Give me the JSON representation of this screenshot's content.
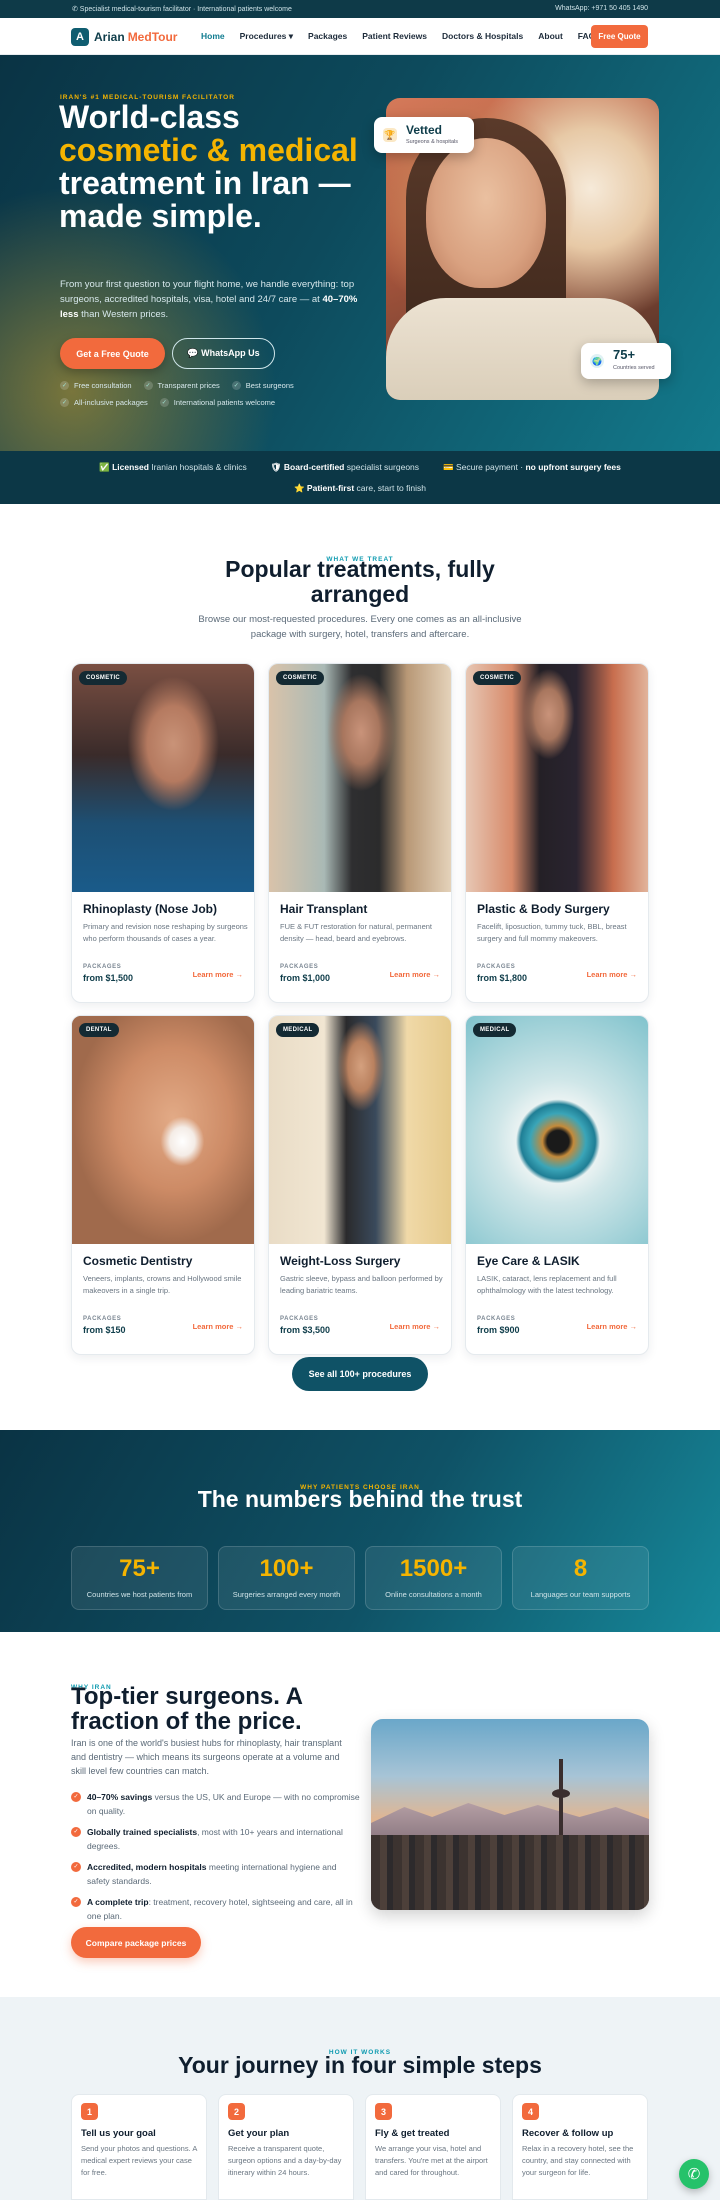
{
  "topbar": {
    "left": "✆ Specialist medical-tourism facilitator · International patients welcome",
    "right": "WhatsApp: +971 50 405 1490"
  },
  "nav": {
    "logo_mark": "A",
    "logo_name": "Arian",
    "logo_accent": "MedTour",
    "items": [
      "Home",
      "Procedures ▾",
      "Packages",
      "Patient Reviews",
      "Doctors & Hospitals",
      "About",
      "FAQ"
    ],
    "cta": "Free Quote"
  },
  "hero": {
    "eyebrow": "IRAN'S #1 MEDICAL-TOURISM FACILITATOR",
    "title_1": "World-class",
    "title_gold": "cosmetic & medical",
    "title_2": "treatment in Iran — made simple.",
    "sub_1": "From your first question to your flight home, we handle everything: top surgeons, accredited hospitals, visa, hotel and 24/7 care — at",
    "sub_bold": "40–70% less",
    "sub_2": "than Western prices.",
    "btn_primary": "Get a Free Quote",
    "btn_secondary": "💬 WhatsApp Us",
    "checks": [
      "Free consultation",
      "Transparent prices",
      "Best surgeons",
      "All-inclusive packages",
      "International patients welcome"
    ],
    "vetted_title": "Vetted",
    "vetted_sub": "Surgeons & hospitals",
    "count_value": "75+",
    "count_label": "Countries served"
  },
  "trust": {
    "item1_bold": "✅ Licensed",
    "item1_rest": "Iranian hospitals & clinics",
    "item2_bold": "🛡 Board-certified",
    "item2_rest": "specialist surgeons",
    "item3_rest": "💳 Secure payment ·",
    "item3_bold": "no upfront surgery fees",
    "item4_bold": "⭐ Patient-first",
    "item4_rest": "care, start to finish"
  },
  "treatments": {
    "eyebrow": "WHAT WE TREAT",
    "title": "Popular treatments, fully arranged",
    "sub": "Browse our most-requested procedures. Every one comes as an all-inclusive package with surgery, hotel, transfers and aftercare.",
    "packages_label": "PACKAGES",
    "more_label": "Learn more →",
    "cards": [
      {
        "tag": "COSMETIC",
        "name": "Rhinoplasty (Nose Job)",
        "desc": "Primary and revision nose reshaping by surgeons who perform thousands of cases a year.",
        "price": "from $1,500"
      },
      {
        "tag": "COSMETIC",
        "name": "Hair Transplant",
        "desc": "FUE & FUT restoration for natural, permanent density — head, beard and eyebrows.",
        "price": "from $1,000"
      },
      {
        "tag": "COSMETIC",
        "name": "Plastic & Body Surgery",
        "desc": "Facelift, liposuction, tummy tuck, BBL, breast surgery and full mommy makeovers.",
        "price": "from $1,800"
      },
      {
        "tag": "DENTAL",
        "name": "Cosmetic Dentistry",
        "desc": "Veneers, implants, crowns and Hollywood smile makeovers in a single trip.",
        "price": "from $150"
      },
      {
        "tag": "MEDICAL",
        "name": "Weight-Loss Surgery",
        "desc": "Gastric sleeve, bypass and balloon performed by leading bariatric teams.",
        "price": "from $3,500"
      },
      {
        "tag": "MEDICAL",
        "name": "Eye Care & LASIK",
        "desc": "LASIK, cataract, lens replacement and full ophthalmology with the latest technology.",
        "price": "from $900"
      }
    ],
    "see_all": "See all 100+ procedures"
  },
  "stats": {
    "eyebrow": "WHY PATIENTS CHOOSE IRAN",
    "title": "The numbers behind the trust",
    "items": [
      {
        "value": "75+",
        "caption": "Countries we host patients from"
      },
      {
        "value": "100+",
        "caption": "Surgeries arranged every month"
      },
      {
        "value": "1500+",
        "caption": "Online consultations a month"
      },
      {
        "value": "8",
        "caption": "Languages our team supports"
      }
    ]
  },
  "why": {
    "eyebrow": "WHY IRAN",
    "title": "Top-tier surgeons. A fraction of the price.",
    "para": "Iran is one of the world's busiest hubs for rhinoplasty, hair transplant and dentistry — which means its surgeons operate at a volume and skill level few countries can match.",
    "bullets": [
      {
        "bold": "40–70% savings",
        "rest": "versus the US, UK and Europe — with no compromise on quality."
      },
      {
        "bold": "Globally trained specialists",
        "rest": ", most with 10+ years and international degrees."
      },
      {
        "bold": "Accredited, modern hospitals",
        "rest": "meeting international hygiene and safety standards."
      },
      {
        "bold": "A complete trip",
        "rest": ": treatment, recovery hotel, sightseeing and care, all in one plan."
      }
    ],
    "cta": "Compare package prices"
  },
  "steps": {
    "eyebrow": "HOW IT WORKS",
    "title": "Your journey in four simple steps",
    "items": [
      {
        "num": "1",
        "title": "Tell us your goal",
        "desc": "Send your photos and questions. A medical expert reviews your case for free."
      },
      {
        "num": "2",
        "title": "Get your plan",
        "desc": "Receive a transparent quote, surgeon options and a day-by-day itinerary within 24 hours."
      },
      {
        "num": "3",
        "title": "Fly & get treated",
        "desc": "We arrange your visa, hotel and transfers. You're met at the airport and cared for throughout."
      },
      {
        "num": "4",
        "title": "Recover & follow up",
        "desc": "Relax in a recovery hotel, see the country, and stay connected with your surgeon for life."
      }
    ]
  },
  "colors": {
    "brand": "#0f5d70",
    "accent": "#f26a3d",
    "gold": "#f5b400"
  },
  "icons": {
    "whatsapp_float": "whatsapp-icon"
  }
}
